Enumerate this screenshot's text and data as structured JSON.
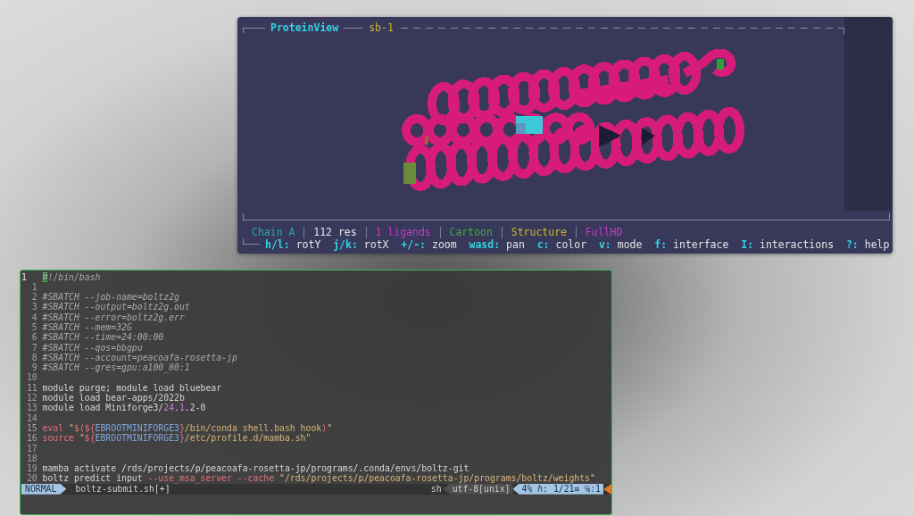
{
  "protein_view": {
    "title": "ProteinView",
    "session": "sb-1",
    "status": [
      {
        "text": "Chain A",
        "color": "#26a8b8"
      },
      {
        "text": "112 res",
        "color": "#e6e6e6"
      },
      {
        "text": "1 ligands",
        "color": "#c43cc8"
      },
      {
        "text": "Cartoon",
        "color": "#3cae3c"
      },
      {
        "text": "Structure",
        "color": "#cbb52a"
      },
      {
        "text": "FullHD",
        "color": "#c43cc8"
      }
    ],
    "keybindings": [
      {
        "key": "h/l:",
        "action": "rotY"
      },
      {
        "key": "j/k:",
        "action": "rotX"
      },
      {
        "key": "+/-:",
        "action": "zoom"
      },
      {
        "key": "wasd:",
        "action": "pan"
      },
      {
        "key": "c:",
        "action": "color"
      },
      {
        "key": "v:",
        "action": "mode"
      },
      {
        "key": "f:",
        "action": "interface"
      },
      {
        "key": "I:",
        "action": "interactions"
      },
      {
        "key": "?:",
        "action": "help"
      }
    ]
  },
  "editor": {
    "lines": [
      {
        "number": "1",
        "current": true,
        "segments": [
          {
            "text": "#",
            "kind": "cursor"
          },
          {
            "text": "!/bin/bash",
            "kind": "comment"
          }
        ]
      },
      {
        "number": "1",
        "current": false
      },
      {
        "number": "2",
        "current": false,
        "segments": [
          {
            "text": "#SBATCH --job-name=boltz2g",
            "kind": "comment"
          }
        ]
      },
      {
        "number": "3",
        "current": false,
        "segments": [
          {
            "text": "#SBATCH --output=boltz2g.out",
            "kind": "comment"
          }
        ]
      },
      {
        "number": "4",
        "current": false,
        "segments": [
          {
            "text": "#SBATCH --error=boltz2g.err",
            "kind": "comment"
          }
        ]
      },
      {
        "number": "5",
        "current": false,
        "segments": [
          {
            "text": "#SBATCH --mem=32G",
            "kind": "comment"
          }
        ]
      },
      {
        "number": "6",
        "current": false,
        "segments": [
          {
            "text": "#SBATCH --time=24:00:00",
            "kind": "comment"
          }
        ]
      },
      {
        "number": "7",
        "current": false,
        "segments": [
          {
            "text": "#SBATCH --qos=bbgpu",
            "kind": "comment"
          }
        ]
      },
      {
        "number": "8",
        "current": false,
        "segments": [
          {
            "text": "#SBATCH --account=peacoafa-rosetta-jp",
            "kind": "comment"
          }
        ]
      },
      {
        "number": "9",
        "current": false,
        "segments": [
          {
            "text": "#SBATCH --gres=gpu:a100_80:1",
            "kind": "comment"
          }
        ]
      },
      {
        "number": "10",
        "current": false
      },
      {
        "number": "11",
        "current": false,
        "segments": [
          {
            "text": "module purge; module load bluebear",
            "kind": "plain"
          }
        ]
      },
      {
        "number": "12",
        "current": false,
        "segments": [
          {
            "text": "module load bear-apps/2022b",
            "kind": "plain"
          }
        ]
      },
      {
        "number": "13",
        "current": false,
        "segments": [
          {
            "text": "module load Miniforge3/",
            "kind": "plain"
          },
          {
            "text": "24",
            "kind": "number"
          },
          {
            "text": ".",
            "kind": "plain"
          },
          {
            "text": "1",
            "kind": "number"
          },
          {
            "text": ".2-0",
            "kind": "plain"
          }
        ]
      },
      {
        "number": "14",
        "current": false
      },
      {
        "number": "15",
        "current": false,
        "segments": [
          {
            "text": "eval ",
            "kind": "keyword"
          },
          {
            "text": "\"",
            "kind": "string"
          },
          {
            "text": "$(${",
            "kind": "special"
          },
          {
            "text": "EBROOTMINIFORGE3",
            "kind": "variable"
          },
          {
            "text": "}",
            "kind": "special"
          },
          {
            "text": "/bin/conda shell.bash hook",
            "kind": "string"
          },
          {
            "text": ")",
            "kind": "special"
          },
          {
            "text": "\"",
            "kind": "string"
          }
        ]
      },
      {
        "number": "16",
        "current": false,
        "segments": [
          {
            "text": "source ",
            "kind": "keyword"
          },
          {
            "text": "\"",
            "kind": "string"
          },
          {
            "text": "${",
            "kind": "special"
          },
          {
            "text": "EBROOTMINIFORGE3",
            "kind": "variable"
          },
          {
            "text": "}",
            "kind": "special"
          },
          {
            "text": "/etc/profile.d/mamba.sh\"",
            "kind": "string"
          }
        ]
      },
      {
        "number": "17",
        "current": false
      },
      {
        "number": "18",
        "current": false
      },
      {
        "number": "19",
        "current": false,
        "segments": [
          {
            "text": "mamba activate /rds/projects/p/peacoafa-rosetta-jp/programs/.conda/envs/boltz-git",
            "kind": "plain"
          }
        ]
      },
      {
        "number": "20",
        "current": false,
        "segments": [
          {
            "text": "boltz predict input ",
            "kind": "plain"
          },
          {
            "text": "--use_msa_server --cache ",
            "kind": "option"
          },
          {
            "text": "\"/rds/projects/p/peacoafa-rosetta-jp/programs/boltz/weights\"",
            "kind": "string"
          }
        ]
      }
    ],
    "status_bar": {
      "mode": "NORMAL",
      "file": "boltz-submit.sh[+]",
      "filetype": "sh",
      "encoding": "utf-8[unix]",
      "position": "4% ℏ: 1/21≡ ℅:1"
    }
  }
}
